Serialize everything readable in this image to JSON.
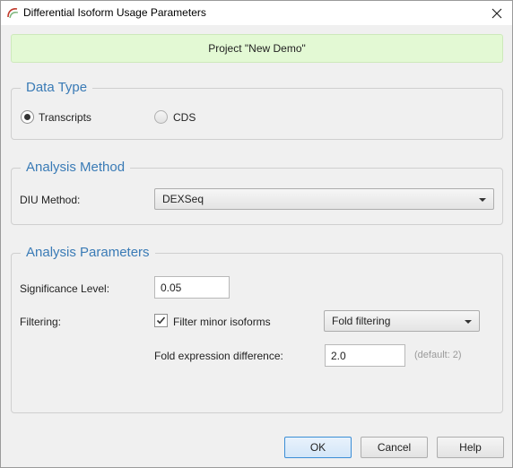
{
  "window": {
    "title": "Differential Isoform Usage Parameters"
  },
  "banner": {
    "text": "Project \"New Demo\""
  },
  "data_type": {
    "title": "Data Type",
    "options": [
      {
        "label": "Transcripts",
        "checked": true
      },
      {
        "label": "CDS",
        "checked": false
      }
    ]
  },
  "analysis_method": {
    "title": "Analysis Method",
    "diu_method_label": "DIU Method:",
    "diu_method_value": "DEXSeq"
  },
  "analysis_parameters": {
    "title": "Analysis Parameters",
    "significance_label": "Significance Level:",
    "significance_value": "0.05",
    "filtering_label": "Filtering:",
    "filter_minor_label": "Filter minor isoforms",
    "filter_minor_checked": true,
    "filter_type_value": "Fold filtering",
    "fold_diff_label": "Fold expression difference:",
    "fold_diff_value": "2.0",
    "fold_diff_hint": "(default: 2)"
  },
  "buttons": {
    "ok": "OK",
    "cancel": "Cancel",
    "help": "Help"
  }
}
